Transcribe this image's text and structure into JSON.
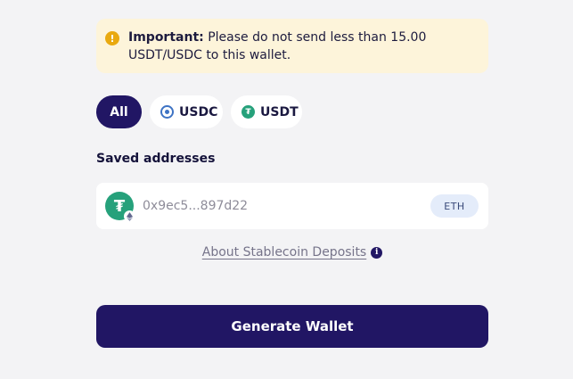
{
  "warning": {
    "icon": "exclamation-icon",
    "bold_prefix": "Important:",
    "message": " Please do not send less than 15.00 USDT/USDC to this wallet.",
    "accent_color": "#e9a90f",
    "background_color": "#fdf4da"
  },
  "filters": [
    {
      "label": "All",
      "active": true
    },
    {
      "label": "USDC",
      "icon": "usdc-icon",
      "active": false
    },
    {
      "label": "USDT",
      "icon": "usdt-icon",
      "active": false
    }
  ],
  "saved_addresses": {
    "title": "Saved addresses",
    "items": [
      {
        "address": "0x9ec5...897d22",
        "network": "ETH",
        "token_icon": "usdt-icon",
        "network_icon": "eth-icon"
      }
    ]
  },
  "about": {
    "link_text": "About Stablecoin Deposits",
    "icon": "info-icon"
  },
  "actions": {
    "generate_label": "Generate Wallet"
  },
  "colors": {
    "primary": "#211664",
    "page_background": "#f3f3f5",
    "usdt_green": "#26a17b",
    "usdc_blue": "#3e73c4"
  }
}
